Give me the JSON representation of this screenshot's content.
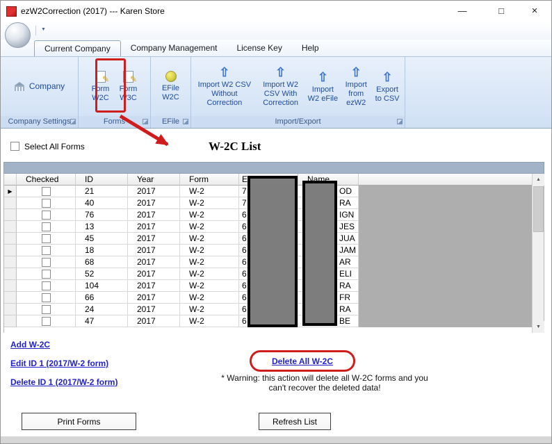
{
  "window": {
    "title": "ezW2Correction (2017) --- Karen Store"
  },
  "icons": {
    "minimize": "—",
    "maximize": "□",
    "close": "×",
    "dropdown_arrow": "▼",
    "import_arrow": "⇧",
    "pencil": "✎",
    "row_selector": "▶",
    "scroll_up": "▲",
    "scroll_down": "▼"
  },
  "tabs": [
    {
      "label": "Current Company",
      "active": true
    },
    {
      "label": "Company Management",
      "active": false
    },
    {
      "label": "License Key",
      "active": false
    },
    {
      "label": "Help",
      "active": false
    }
  ],
  "ribbon": {
    "groups": [
      {
        "label": "Company Settings",
        "buttons": [
          {
            "label": "Company"
          }
        ]
      },
      {
        "label": "Forms",
        "buttons": [
          {
            "label": "Form W2C"
          },
          {
            "label": "Form W3C"
          }
        ]
      },
      {
        "label": "EFile",
        "buttons": [
          {
            "label": "EFile W2C"
          }
        ]
      },
      {
        "label": "Import/Export",
        "buttons": [
          {
            "label": "Import W2 CSV Without Correction"
          },
          {
            "label": "Import W2 CSV With Correction"
          },
          {
            "label": "Import W2 eFile"
          },
          {
            "label": "Import from ezW2"
          },
          {
            "label": "Export to CSV"
          }
        ]
      }
    ]
  },
  "content": {
    "select_all_label": "Select All Forms",
    "list_title": "W-2C List"
  },
  "grid": {
    "columns": [
      "Checked",
      "ID",
      "Year",
      "Form",
      "E",
      "Name"
    ],
    "rows": [
      {
        "id": "21",
        "year": "2017",
        "form": "W-2",
        "ssn_partial": "7",
        "name_partial": "OD"
      },
      {
        "id": "40",
        "year": "2017",
        "form": "W-2",
        "ssn_partial": "7",
        "name_partial": "RA"
      },
      {
        "id": "76",
        "year": "2017",
        "form": "W-2",
        "ssn_partial": "6",
        "name_partial": "IGN"
      },
      {
        "id": "13",
        "year": "2017",
        "form": "W-2",
        "ssn_partial": "6",
        "name_partial": "JES"
      },
      {
        "id": "45",
        "year": "2017",
        "form": "W-2",
        "ssn_partial": "6",
        "name_partial": "JUA"
      },
      {
        "id": "18",
        "year": "2017",
        "form": "W-2",
        "ssn_partial": "6",
        "name_partial": "JAM"
      },
      {
        "id": "68",
        "year": "2017",
        "form": "W-2",
        "ssn_partial": "6",
        "name_partial": "AR"
      },
      {
        "id": "52",
        "year": "2017",
        "form": "W-2",
        "ssn_partial": "6",
        "name_partial": "ELI"
      },
      {
        "id": "104",
        "year": "2017",
        "form": "W-2",
        "ssn_partial": "6",
        "name_partial": "RA"
      },
      {
        "id": "66",
        "year": "2017",
        "form": "W-2",
        "ssn_partial": "6",
        "name_partial": "FR"
      },
      {
        "id": "24",
        "year": "2017",
        "form": "W-2",
        "ssn_partial": "6",
        "name_partial": "RA"
      },
      {
        "id": "47",
        "year": "2017",
        "form": "W-2",
        "ssn_partial": "6",
        "name_partial": "BE"
      }
    ]
  },
  "links": {
    "add": "Add W-2C",
    "edit": "Edit ID 1 (2017/W-2 form)",
    "delete_one": "Delete ID 1 (2017/W-2 form)",
    "delete_all": "Delete All W-2C"
  },
  "warning": {
    "line1": "* Warning: this action will delete all W-2C forms and you",
    "line2": "can't recover the deleted data!"
  },
  "footer_buttons": {
    "print": "Print Forms",
    "refresh": "Refresh List"
  },
  "colors": {
    "annotation_red": "#cf1d1d",
    "link_blue": "#2222cc",
    "ribbon_text_blue": "#1c4a9e"
  }
}
